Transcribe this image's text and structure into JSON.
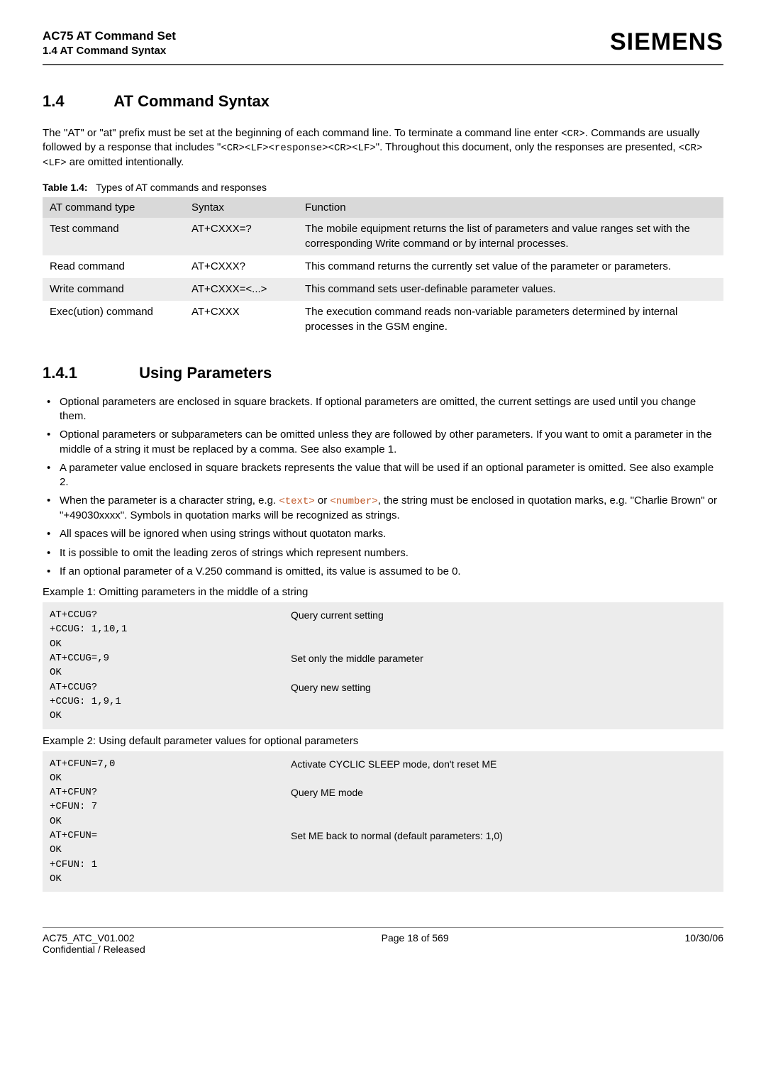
{
  "header": {
    "title": "AC75 AT Command Set",
    "subtitle": "1.4 AT Command Syntax",
    "brand": "SIEMENS"
  },
  "section_1_4": {
    "num": "1.4",
    "title": "AT Command Syntax",
    "para_pre": "The \"AT\" or \"at\" prefix must be set at the beginning of each command line. To terminate a command line enter ",
    "cr1": "<CR>",
    "para_mid1": ". Commands are usually followed by a response that includes \"",
    "resp": "<CR><LF><response><CR><LF>",
    "para_mid2": "\". Throughout this document, only the responses are presented, ",
    "crlf": "<CR><LF>",
    "para_end": " are omitted intentionally."
  },
  "table": {
    "caption_label": "Table 1.4:",
    "caption_text": "Types of AT commands and responses",
    "headers": {
      "c1": "AT command type",
      "c2": "Syntax",
      "c3": "Function"
    },
    "rows": [
      {
        "c1": "Test command",
        "c2": "AT+CXXX=?",
        "c3": "The mobile equipment returns the list of parameters and value ranges set with the corresponding Write command or by internal processes."
      },
      {
        "c1": "Read command",
        "c2": "AT+CXXX?",
        "c3": "This command returns the currently set value of the parameter or parameters."
      },
      {
        "c1": "Write command",
        "c2": "AT+CXXX=<...>",
        "c3": "This command sets user-definable parameter values."
      },
      {
        "c1": "Exec(ution) command",
        "c2": "AT+CXXX",
        "c3": "The execution command reads non-variable parameters determined by internal processes in the GSM engine."
      }
    ]
  },
  "section_1_4_1": {
    "num": "1.4.1",
    "title": "Using Parameters",
    "bullets": {
      "b0": "Optional parameters are enclosed in square brackets. If optional parameters are omitted, the current settings are used until you change them.",
      "b1": "Optional parameters or subparameters can be omitted unless they are followed by other parameters. If you want to omit a parameter in the middle of a string it must be replaced by a comma. See also example 1.",
      "b2": "A parameter value enclosed in square brackets represents the value that will be used if an optional parameter is omitted. See also example 2.",
      "b3_pre": "When the parameter is a character string, e.g. ",
      "b3_p1": "<text>",
      "b3_mid": " or ",
      "b3_p2": "<number>",
      "b3_post": ", the string must be enclosed in quotation marks, e.g. \"Charlie Brown\" or \"+49030xxxx\". Symbols in quotation marks will be recognized as strings.",
      "b4": "All spaces will be ignored when using strings without quotaton marks.",
      "b5": "It is possible to omit the leading zeros of strings which represent numbers.",
      "b6": "If an optional parameter of a V.250 command is omitted, its value is assumed to be 0."
    }
  },
  "example1": {
    "label": "Example 1: Omitting parameters in the middle of a string",
    "lines": [
      {
        "cmd": "AT+CCUG?",
        "desc": "Query current setting"
      },
      {
        "cmd": "+CCUG: 1,10,1",
        "desc": ""
      },
      {
        "cmd": "OK",
        "desc": ""
      },
      {
        "cmd": "AT+CCUG=,9",
        "desc": "Set only the middle parameter"
      },
      {
        "cmd": "OK",
        "desc": ""
      },
      {
        "cmd": "AT+CCUG?",
        "desc": "Query new setting"
      },
      {
        "cmd": "+CCUG: 1,9,1",
        "desc": ""
      },
      {
        "cmd": "OK",
        "desc": ""
      }
    ]
  },
  "example2": {
    "label": "Example 2: Using default parameter values for optional parameters",
    "lines": [
      {
        "cmd": "AT+CFUN=7,0",
        "desc": "Activate CYCLIC SLEEP mode, don't reset ME"
      },
      {
        "cmd": "OK",
        "desc": ""
      },
      {
        "cmd": "AT+CFUN?",
        "desc": "Query ME mode"
      },
      {
        "cmd": "+CFUN: 7",
        "desc": ""
      },
      {
        "cmd": "OK",
        "desc": ""
      },
      {
        "cmd": "AT+CFUN=",
        "desc": "Set ME back to normal (default parameters: 1,0)"
      },
      {
        "cmd": "OK",
        "desc": ""
      },
      {
        "cmd": "+CFUN: 1",
        "desc": ""
      },
      {
        "cmd": "OK",
        "desc": ""
      }
    ]
  },
  "footer": {
    "left1": "AC75_ATC_V01.002",
    "left2": "Confidential / Released",
    "center": "Page 18 of 569",
    "right": "10/30/06"
  }
}
